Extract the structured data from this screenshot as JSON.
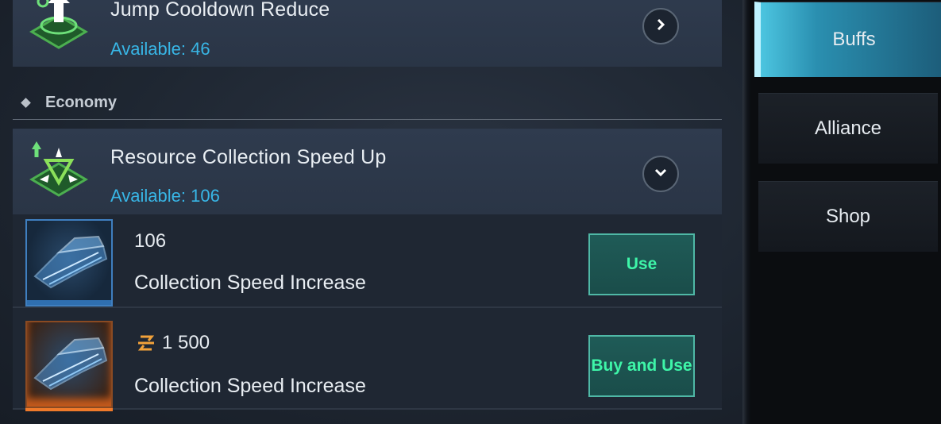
{
  "buffs_list": {
    "jump_card": {
      "title": "Jump Cooldown Reduce",
      "available": "Available: 46",
      "icon": "jump-boost-icon",
      "expand_icon": "chevron-right-icon"
    },
    "section": {
      "label": "Economy",
      "icon": "diamond-bullet-icon"
    },
    "resource_card": {
      "title": "Resource Collection Speed Up",
      "available": "Available: 106",
      "icon": "resource-speed-icon",
      "expand_icon": "chevron-down-icon"
    },
    "items": [
      {
        "amount": "106",
        "description": "Collection Speed Increase",
        "action": "Use",
        "frame_color": "#3f7fc0"
      },
      {
        "currency_icon": "currency-icon",
        "amount": "1 500",
        "description": "Collection Speed Increase",
        "action": "Buy and Use",
        "frame_color": "#f07a2a"
      }
    ]
  },
  "side_tabs": [
    {
      "label": "Buffs",
      "active": true
    },
    {
      "label": "Alliance",
      "active": false
    },
    {
      "label": "Shop",
      "active": false
    }
  ],
  "colors": {
    "available_text": "#38b6e6",
    "action_text": "#3ef5a8",
    "accent": "#4cc5e0"
  }
}
